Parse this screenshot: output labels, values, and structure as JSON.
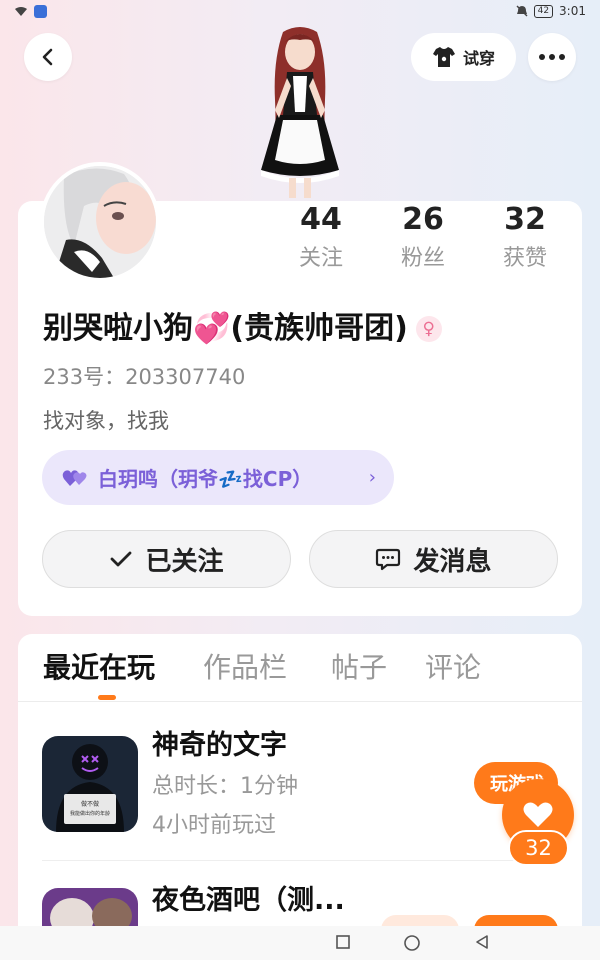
{
  "status_bar": {
    "battery": "42",
    "time": "3:01"
  },
  "header": {
    "tryon_label": "试穿"
  },
  "stats": [
    {
      "value": "44",
      "label": "关注"
    },
    {
      "value": "26",
      "label": "粉丝"
    },
    {
      "value": "32",
      "label": "获赞"
    }
  ],
  "profile": {
    "nickname": "别哭啦小狗💞(贵族帅哥团)",
    "gender_symbol": "♀",
    "uid": "233号：203307740",
    "bio": "找对象，找我",
    "cp_text": "白玥鸣（玥爷💤找CP）",
    "cp_chevron": "›"
  },
  "actions": {
    "follow_label": "已关注",
    "message_label": "发消息"
  },
  "tabs": [
    {
      "label": "最近在玩",
      "active": true
    },
    {
      "label": "作品栏",
      "active": false
    },
    {
      "label": "帖子",
      "active": false
    },
    {
      "label": "评论",
      "active": false
    }
  ],
  "games": [
    {
      "title": "神奇的文字",
      "duration": "总时长：1分钟",
      "last_played": "4小时前玩过",
      "button_label": "玩游戏",
      "thumb_text_line1": "做不做",
      "thumb_text_line2": "我能做出你的年龄"
    },
    {
      "title": "夜色酒吧（测..."
    }
  ],
  "like": {
    "count": "32"
  },
  "colors": {
    "accent": "#ff7a1a",
    "cp_purple": "#7b60d8",
    "gender_pink": "#ec6f93"
  }
}
